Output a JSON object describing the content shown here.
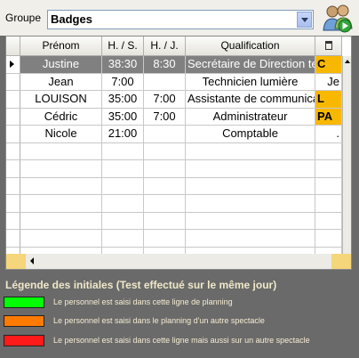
{
  "header": {
    "group_label": "Groupe",
    "group_value": "Badges"
  },
  "table": {
    "columns": [
      "Prénom",
      "H. / S.",
      "H. / J.",
      "Qualification"
    ],
    "rows": [
      {
        "prenom": "Justine",
        "hs": "38:30",
        "hj": "8:30",
        "qualification": "Secrétaire de Direction tec",
        "extra": "C",
        "selected": true
      },
      {
        "prenom": "Jean",
        "hs": "7:00",
        "hj": "",
        "qualification": "Technicien lumière",
        "extra": "Je",
        "selected": false
      },
      {
        "prenom": "LOUISON",
        "hs": "35:00",
        "hj": "7:00",
        "qualification": "Assistante de communica",
        "extra": "L",
        "selected": false
      },
      {
        "prenom": "Cédric",
        "hs": "35:00",
        "hj": "7:00",
        "qualification": "Administrateur",
        "extra": "PA",
        "selected": false
      },
      {
        "prenom": "Nicole",
        "hs": "21:00",
        "hj": "",
        "qualification": "Comptable",
        "extra": ".",
        "selected": false
      }
    ],
    "orange_extra_rows": [
      0,
      2,
      3
    ],
    "empty_rows": 7
  },
  "legend": {
    "title": "Légende des initiales (Test effectué sur le même jour)",
    "items": [
      {
        "color": "#00ff00",
        "text": "Le personnel est saisi dans cette ligne de planning"
      },
      {
        "color": "#ff7a00",
        "text": "Le personnel est saisi  dans le planning d'un autre spectacle"
      },
      {
        "color": "#ff1a1a",
        "text": "Le personnel est saisi dans cette ligne mais aussi sur un autre spectacle"
      }
    ]
  }
}
